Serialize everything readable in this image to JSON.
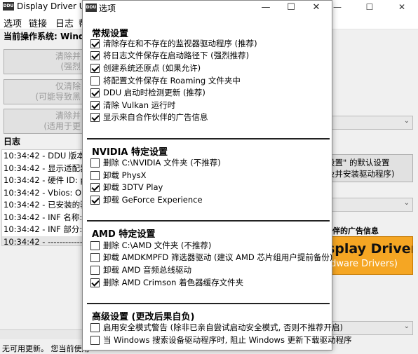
{
  "main": {
    "title": "Display Driver Unin",
    "icon_label": "DDU",
    "window_controls": [
      "—",
      "☐",
      "✕"
    ],
    "menu": [
      "选项",
      "链接",
      "日志",
      "帮"
    ],
    "os_label": "当前操作系统: Window",
    "buttons": [
      {
        "line1": "清除并",
        "line2": "(强烈"
      },
      {
        "line1": "仅清除",
        "line2": "(可能导致黑"
      },
      {
        "line1": "清除并",
        "line2": "(适用于更"
      }
    ],
    "log_label": "日志",
    "log": [
      "10:34:42 - DDU 版本: 1",
      "10:34:42 - 显示适配器 #",
      "10:34:42 - 硬件 ID: pci\\",
      "10:34:42 - Vbios: Oracl",
      "10:34:42 - 已安装的驱动",
      "10:34:42 - INF 名称: oe",
      "10:34:42 - INF 部分: VB",
      "10:34:42 - ------------"
    ],
    "right_button": {
      "line1": "设置\" 的默认设置",
      "line2": "及并安装驱动程序)"
    },
    "partner_label": "伙伴的广告信息",
    "banner": {
      "line1": "splay Driver",
      "line2": "rdware Drivers)"
    },
    "status": "无可用更新。 您当前使用"
  },
  "dialog": {
    "title": "选项",
    "icon_label": "DDU",
    "controls": [
      "—",
      "☐",
      "✕"
    ],
    "sections": [
      {
        "title": "常规设置",
        "options": [
          {
            "label": "清除存在和不存在的监视器驱动程序 (推荐)",
            "checked": true
          },
          {
            "label": "将日志文件保存在启动路径下 (强烈推荐)",
            "checked": true
          },
          {
            "label": "创建系统还原点 (如果允许)",
            "checked": true
          },
          {
            "label": "将配置文件保存在 Roaming 文件夹中",
            "checked": false
          },
          {
            "label": "DDU 启动时检测更新 (推荐)",
            "checked": true
          },
          {
            "label": "清除 Vulkan 运行时",
            "checked": true
          },
          {
            "label": "显示来自合作伙伴的广告信息",
            "checked": true
          }
        ]
      },
      {
        "title": "NVIDIA 特定设置",
        "options": [
          {
            "label": "删除 C:\\NVIDIA 文件夹 (不推荐)",
            "checked": false
          },
          {
            "label": "卸载 PhysX",
            "checked": false
          },
          {
            "label": "卸载 3DTV Play",
            "checked": true
          },
          {
            "label": "卸载 GeForce Experience",
            "checked": true
          }
        ]
      },
      {
        "title": "AMD 特定设置",
        "options": [
          {
            "label": "删除 C:\\AMD 文件夹 (不推荐)",
            "checked": false
          },
          {
            "label": "卸载 AMDKMPFD 筛选器驱动 (建议 AMD 芯片组用户提前备份)",
            "checked": false
          },
          {
            "label": "卸载 AMD 音频总线驱动",
            "checked": false
          },
          {
            "label": "删除 AMD Crimson 着色器缓存文件夹",
            "checked": true
          }
        ]
      },
      {
        "title": "高级设置 (更改后果自负)",
        "options": [
          {
            "label": "启用安全模式警告 (除非已亲自尝试启动安全模式, 否则不推荐开启)",
            "checked": false
          },
          {
            "label": "当 Windows 搜索设备驱动程序时, 阻止 Windows 更新下载驱动程序",
            "checked": false
          }
        ]
      }
    ]
  }
}
